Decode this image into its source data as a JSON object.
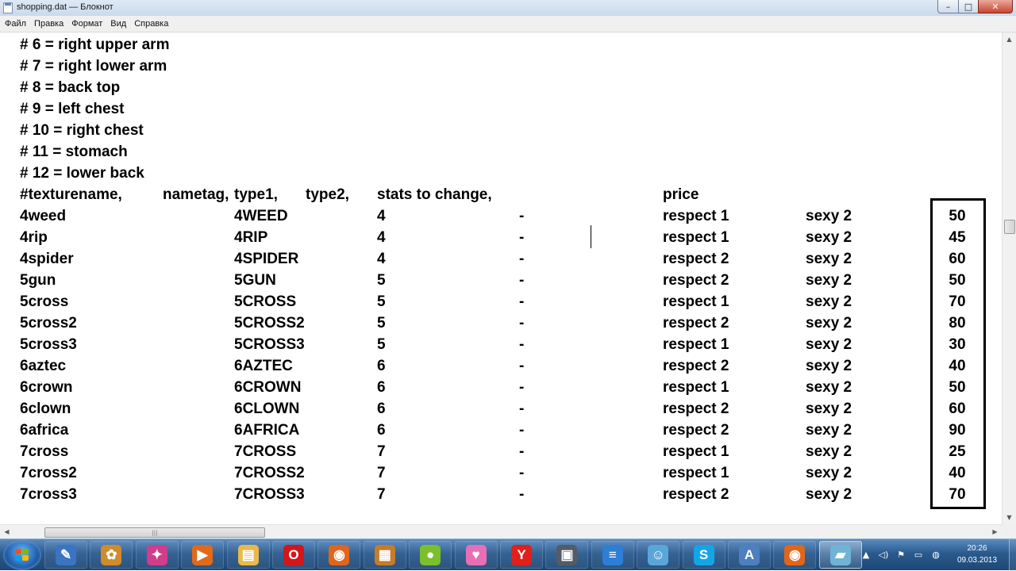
{
  "window": {
    "title": "shopping.dat — Блокнот",
    "controls": {
      "minimize": "–",
      "maximize": "□",
      "close": "✕"
    }
  },
  "menu": [
    "Файл",
    "Правка",
    "Формат",
    "Вид",
    "Справка"
  ],
  "comments": [
    "# 6 = right upper arm",
    "# 7 = right lower arm",
    "# 8 = back top",
    "# 9 = left chest",
    "# 10 = right chest",
    "# 11 = stomach",
    "# 12 = lower back"
  ],
  "header": {
    "texturename": "#texturename,",
    "nametag": "nametag,",
    "type1": "type1,",
    "type2": "type2,",
    "stats": "stats to change,",
    "price": "price"
  },
  "rows": [
    {
      "texture": "4weed",
      "tag": "4WEED",
      "type1": "4",
      "type2": "-",
      "stat1": "respect 1",
      "stat2": "sexy 2",
      "price": "50"
    },
    {
      "texture": "4rip",
      "tag": "4RIP",
      "type1": "4",
      "type2": "-",
      "stat1": "respect 1",
      "stat2": "sexy 2",
      "price": "45"
    },
    {
      "texture": "4spider",
      "tag": "4SPIDER",
      "type1": "4",
      "type2": "-",
      "stat1": "respect 2",
      "stat2": "sexy 2",
      "price": "60"
    },
    {
      "texture": "5gun",
      "tag": "5GUN",
      "type1": "5",
      "type2": "-",
      "stat1": "respect 2",
      "stat2": "sexy 2",
      "price": "50"
    },
    {
      "texture": "5cross",
      "tag": "5CROSS",
      "type1": "5",
      "type2": "-",
      "stat1": "respect 1",
      "stat2": "sexy 2",
      "price": "70"
    },
    {
      "texture": "5cross2",
      "tag": "5CROSS2",
      "type1": "5",
      "type2": "-",
      "stat1": "respect 2",
      "stat2": "sexy 2",
      "price": "80"
    },
    {
      "texture": "5cross3",
      "tag": "5CROSS3",
      "type1": "5",
      "type2": "-",
      "stat1": "respect 1",
      "stat2": "sexy 2",
      "price": "30"
    },
    {
      "texture": "6aztec",
      "tag": "6AZTEC",
      "type1": "6",
      "type2": "-",
      "stat1": "respect 2",
      "stat2": "sexy 2",
      "price": "40"
    },
    {
      "texture": "6crown",
      "tag": "6CROWN",
      "type1": "6",
      "type2": "-",
      "stat1": "respect 1",
      "stat2": "sexy 2",
      "price": "50"
    },
    {
      "texture": "6clown",
      "tag": "6CLOWN",
      "type1": "6",
      "type2": "-",
      "stat1": "respect 2",
      "stat2": "sexy 2",
      "price": "60"
    },
    {
      "texture": "6africa",
      "tag": "6AFRICA",
      "type1": "6",
      "type2": "-",
      "stat1": "respect 2",
      "stat2": "sexy 2",
      "price": "90"
    },
    {
      "texture": "7cross",
      "tag": "7CROSS",
      "type1": "7",
      "type2": "-",
      "stat1": "respect 1",
      "stat2": "sexy 2",
      "price": "25"
    },
    {
      "texture": "7cross2",
      "tag": "7CROSS2",
      "type1": "7",
      "type2": "-",
      "stat1": "respect 1",
      "stat2": "sexy 2",
      "price": "40"
    },
    {
      "texture": "7cross3",
      "tag": "7CROSS3",
      "type1": "7",
      "type2": "-",
      "stat1": "respect 2",
      "stat2": "sexy 2",
      "price": "70"
    }
  ],
  "taskbar": {
    "apps": [
      {
        "name": "desktop-app-icon",
        "glyph": "✎",
        "color": "#3a74c4"
      },
      {
        "name": "paint-icon",
        "glyph": "✿",
        "color": "#d08b2a"
      },
      {
        "name": "pinwheel-icon",
        "glyph": "✦",
        "color": "#cf3d8b"
      },
      {
        "name": "media-player-icon",
        "glyph": "▶",
        "color": "#e06a1b"
      },
      {
        "name": "folder-icon",
        "glyph": "▤",
        "color": "#e9b949"
      },
      {
        "name": "opera-icon",
        "glyph": "O",
        "color": "#d3161b"
      },
      {
        "name": "firefox-icon",
        "glyph": "◉",
        "color": "#e0661b"
      },
      {
        "name": "package-icon",
        "glyph": "▦",
        "color": "#c67c2a"
      },
      {
        "name": "ball-app-icon",
        "glyph": "●",
        "color": "#7bbf2b"
      },
      {
        "name": "photo-app-icon",
        "glyph": "♥",
        "color": "#e76fb6"
      },
      {
        "name": "yandex-icon",
        "glyph": "Y",
        "color": "#e0201b"
      },
      {
        "name": "floppy-icon",
        "glyph": "▣",
        "color": "#555c66"
      },
      {
        "name": "stack-app-icon",
        "glyph": "≡",
        "color": "#2d7ed6"
      },
      {
        "name": "people-app-icon",
        "glyph": "☺",
        "color": "#5aa6d8"
      },
      {
        "name": "skype-icon",
        "glyph": "S",
        "color": "#13a5e8"
      },
      {
        "name": "document-app-icon",
        "glyph": "A",
        "color": "#4e7fbf"
      },
      {
        "name": "firefox-icon-2",
        "glyph": "◉",
        "color": "#e0661b"
      },
      {
        "name": "notepad-icon",
        "glyph": "▰",
        "color": "#6fb4d6"
      }
    ],
    "active_index": 17,
    "tray": [
      "▲",
      "◁)",
      "⚑",
      "▭",
      "◍"
    ],
    "time": "20:26",
    "date": "09.03.2013"
  }
}
